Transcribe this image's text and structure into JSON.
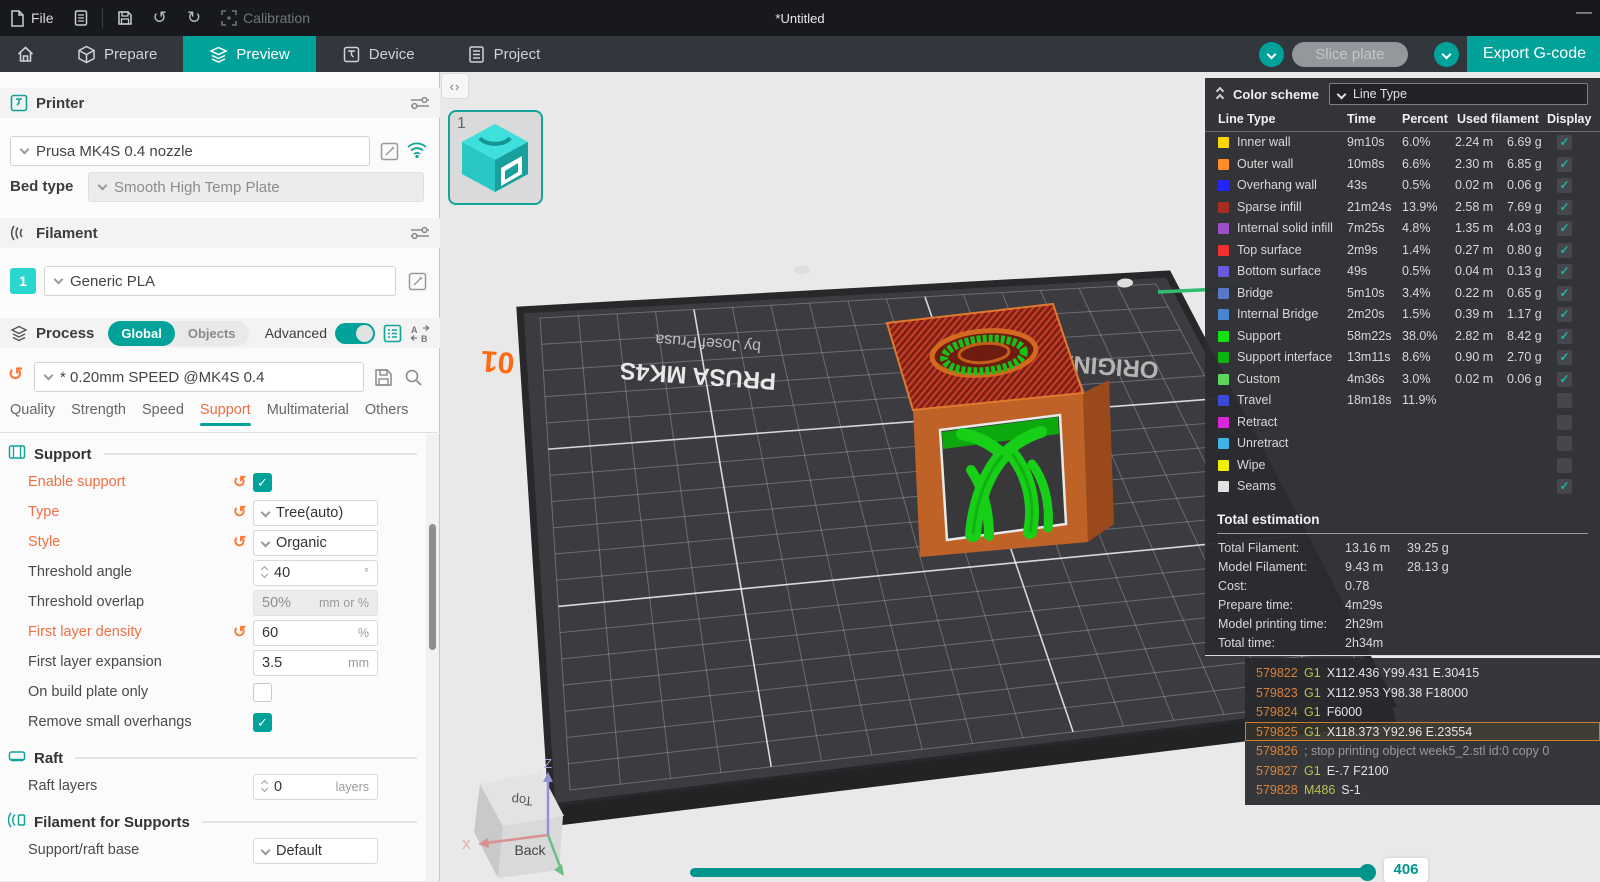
{
  "colors": {
    "accent": "#00a29a",
    "modified_orange": "#ee7044",
    "prusa_orange": "#ff6a13"
  },
  "titlebar": {
    "file": "File",
    "calibration": "Calibration",
    "title": "*Untitled",
    "minimize": "—"
  },
  "tabbar": {
    "tabs": [
      {
        "label": "Prepare"
      },
      {
        "label": "Preview"
      },
      {
        "label": "Device"
      },
      {
        "label": "Project"
      }
    ],
    "active": "Preview",
    "slice_label": "Slice plate",
    "export_label": "Export G-code"
  },
  "printer": {
    "title": "Printer",
    "preset": "Prusa MK4S 0.4 nozzle",
    "bed_type_label": "Bed type",
    "bed_type_value": "Smooth High Temp Plate"
  },
  "filament": {
    "title": "Filament",
    "slot": "1",
    "preset": "Generic PLA"
  },
  "process": {
    "title": "Process",
    "seg_global": "Global",
    "seg_objects": "Objects",
    "advanced_label": "Advanced",
    "preset": "* 0.20mm SPEED @MK4S 0.4",
    "tabs": [
      "Quality",
      "Strength",
      "Speed",
      "Support",
      "Multimaterial",
      "Others"
    ],
    "active_tab": "Support"
  },
  "settings_groups": [
    {
      "title": "Support",
      "rows": [
        {
          "label": "Enable support",
          "modified": true,
          "undo": true,
          "control": "checkbox",
          "checked": true
        },
        {
          "label": "Type",
          "modified": true,
          "undo": true,
          "control": "select",
          "value": "Tree(auto)"
        },
        {
          "label": "Style",
          "modified": true,
          "undo": true,
          "control": "select",
          "value": "Organic"
        },
        {
          "label": "Threshold angle",
          "control": "spinner",
          "value": "40",
          "unit": "°"
        },
        {
          "label": "Threshold overlap",
          "control": "input",
          "disabled": true,
          "value": "50%",
          "unit": "mm or %"
        },
        {
          "label": "First layer density",
          "modified": true,
          "undo": true,
          "control": "input",
          "value": "60",
          "unit": "%"
        },
        {
          "label": "First layer expansion",
          "control": "input",
          "value": "3.5",
          "unit": "mm"
        },
        {
          "label": "On build plate only",
          "control": "checkbox",
          "checked": false
        },
        {
          "label": "Remove small overhangs",
          "control": "checkbox",
          "checked": true
        }
      ]
    },
    {
      "title": "Raft",
      "rows": [
        {
          "label": "Raft layers",
          "control": "spinner",
          "value": "0",
          "unit": "layers"
        }
      ]
    },
    {
      "title": "Filament for Supports",
      "rows": [
        {
          "label": "Support/raft base",
          "control": "select",
          "value": "Default"
        }
      ]
    }
  ],
  "viewport": {
    "plate_number": "1",
    "plate_texts": {
      "corner": "01",
      "byline": "by Josef Prusa",
      "brand": "PRUSA MK4S",
      "original": "ORIGINAL"
    },
    "nav_cube": {
      "top": "Top",
      "back": "Back",
      "z": "Z",
      "x": "X"
    },
    "slider_value": "406"
  },
  "color_scheme": {
    "title": "Color scheme",
    "mode": "Line Type",
    "columns": [
      "Line Type",
      "Time",
      "Percent",
      "Used filament",
      "Display"
    ],
    "rows": [
      {
        "name": "Inner wall",
        "color": "#fcd800",
        "time": "9m10s",
        "percent": "6.0%",
        "used_m": "2.24 m",
        "used_g": "6.69 g",
        "display": true
      },
      {
        "name": "Outer wall",
        "color": "#ff8c28",
        "time": "10m8s",
        "percent": "6.6%",
        "used_m": "2.30 m",
        "used_g": "6.85 g",
        "display": true
      },
      {
        "name": "Overhang wall",
        "color": "#2424ff",
        "time": "43s",
        "percent": "0.5%",
        "used_m": "0.02 m",
        "used_g": "0.06 g",
        "display": true
      },
      {
        "name": "Sparse infill",
        "color": "#a82c20",
        "time": "21m24s",
        "percent": "13.9%",
        "used_m": "2.58 m",
        "used_g": "7.69 g",
        "display": true
      },
      {
        "name": "Internal solid infill",
        "color": "#9e4fc8",
        "time": "7m25s",
        "percent": "4.8%",
        "used_m": "1.35 m",
        "used_g": "4.03 g",
        "display": true
      },
      {
        "name": "Top surface",
        "color": "#f23030",
        "time": "2m9s",
        "percent": "1.4%",
        "used_m": "0.27 m",
        "used_g": "0.80 g",
        "display": true
      },
      {
        "name": "Bottom surface",
        "color": "#6a5ae0",
        "time": "49s",
        "percent": "0.5%",
        "used_m": "0.04 m",
        "used_g": "0.13 g",
        "display": true
      },
      {
        "name": "Bridge",
        "color": "#5a76c8",
        "time": "5m10s",
        "percent": "3.4%",
        "used_m": "0.22 m",
        "used_g": "0.65 g",
        "display": true
      },
      {
        "name": "Internal Bridge",
        "color": "#4a86d0",
        "time": "2m20s",
        "percent": "1.5%",
        "used_m": "0.39 m",
        "used_g": "1.17 g",
        "display": true
      },
      {
        "name": "Support",
        "color": "#12e212",
        "time": "58m22s",
        "percent": "38.0%",
        "used_m": "2.82 m",
        "used_g": "8.42 g",
        "display": true
      },
      {
        "name": "Support interface",
        "color": "#0eb40e",
        "time": "13m11s",
        "percent": "8.6%",
        "used_m": "0.90 m",
        "used_g": "2.70 g",
        "display": true
      },
      {
        "name": "Custom",
        "color": "#5cd65c",
        "time": "4m36s",
        "percent": "3.0%",
        "used_m": "0.02 m",
        "used_g": "0.06 g",
        "display": true
      },
      {
        "name": "Travel",
        "color": "#3a4ad4",
        "time": "18m18s",
        "percent": "11.9%",
        "used_m": "",
        "used_g": "",
        "display": false
      },
      {
        "name": "Retract",
        "color": "#d926d9",
        "time": "",
        "percent": "",
        "used_m": "",
        "used_g": "",
        "display": false
      },
      {
        "name": "Unretract",
        "color": "#3fb4e6",
        "time": "",
        "percent": "",
        "used_m": "",
        "used_g": "",
        "display": false
      },
      {
        "name": "Wipe",
        "color": "#f0f000",
        "time": "",
        "percent": "",
        "used_m": "",
        "used_g": "",
        "display": false
      },
      {
        "name": "Seams",
        "color": "#e0e0e0",
        "time": "",
        "percent": "",
        "used_m": "",
        "used_g": "",
        "display": true
      }
    ],
    "total": {
      "title": "Total estimation",
      "rows": [
        {
          "label": "Total Filament:",
          "v1": "13.16 m",
          "v2": "39.25 g"
        },
        {
          "label": "Model Filament:",
          "v1": "9.43 m",
          "v2": "28.13 g"
        },
        {
          "label": "Cost:",
          "v1": "0.78",
          "v2": ""
        },
        {
          "label": "Prepare time:",
          "v1": "4m29s",
          "v2": ""
        },
        {
          "label": "Model printing time:",
          "v1": "2h29m",
          "v2": ""
        },
        {
          "label": "Total time:",
          "v1": "2h34m",
          "v2": ""
        }
      ]
    }
  },
  "gcode": {
    "lines": [
      {
        "num": "579822",
        "cmd": "G1",
        "args": "X112.436 Y99.431 E.30415"
      },
      {
        "num": "579823",
        "cmd": "G1",
        "args": "X112.953 Y98.38 F18000"
      },
      {
        "num": "579824",
        "cmd": "G1",
        "args": "F6000"
      },
      {
        "num": "579825",
        "cmd": "G1",
        "args": "X118.373 Y92.96 E.23554",
        "highlight": true
      },
      {
        "num": "579826",
        "comment": "; stop printing object week5_2.stl id:0 copy 0"
      },
      {
        "num": "579827",
        "cmd": "G1",
        "args": "E-.7 F2100"
      },
      {
        "num": "579828",
        "cmd": "M486",
        "args": "S-1"
      }
    ]
  }
}
